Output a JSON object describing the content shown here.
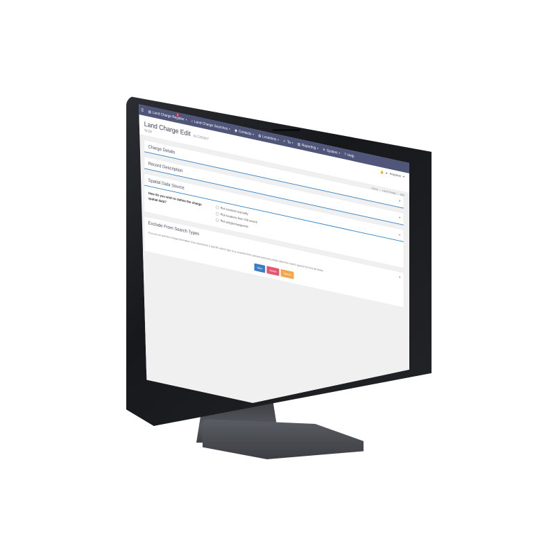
{
  "nav": {
    "items": [
      {
        "label": "Land Charge Register",
        "badge": "1"
      },
      {
        "label": "Land Charge Searches"
      },
      {
        "label": "Contacts"
      },
      {
        "label": "Locations"
      },
      {
        "label": "Ta"
      },
      {
        "label": "Reporting"
      },
      {
        "label": "System"
      },
      {
        "label": "Help"
      }
    ],
    "user_label": "Helpdesk"
  },
  "header": {
    "title": "Land Charge Edit",
    "reference": "#LC250007",
    "subtitle": "To Do",
    "breadcrumbs": [
      "Home",
      "Land Charge",
      "Edit"
    ]
  },
  "panels": {
    "charge_details": "Charge Details",
    "record_description": "Record Description",
    "spatial_data_source": "Spatial Data Source",
    "spatial_question": "How do you wish to define the charge spatial data?",
    "spatial_options": [
      "Plot locations manually",
      "Pick locations from GIS search",
      "Plot polygon/waypoints"
    ],
    "exclude_title": "Exclude From Search Types",
    "exclude_text": "If you do not wish this charge information to be returned for a specific search type (e.g. excluded from optional searches) please select the search type(s) from the list below."
  },
  "actions": {
    "save": "Save",
    "delete": "Delete",
    "cancel": "Cancel"
  },
  "colors": {
    "navbar": "#4f5679",
    "accent_line": "#2d7ec3",
    "save": "#3a7dc6",
    "delete": "#e2566e",
    "cancel": "#f5a64a"
  }
}
